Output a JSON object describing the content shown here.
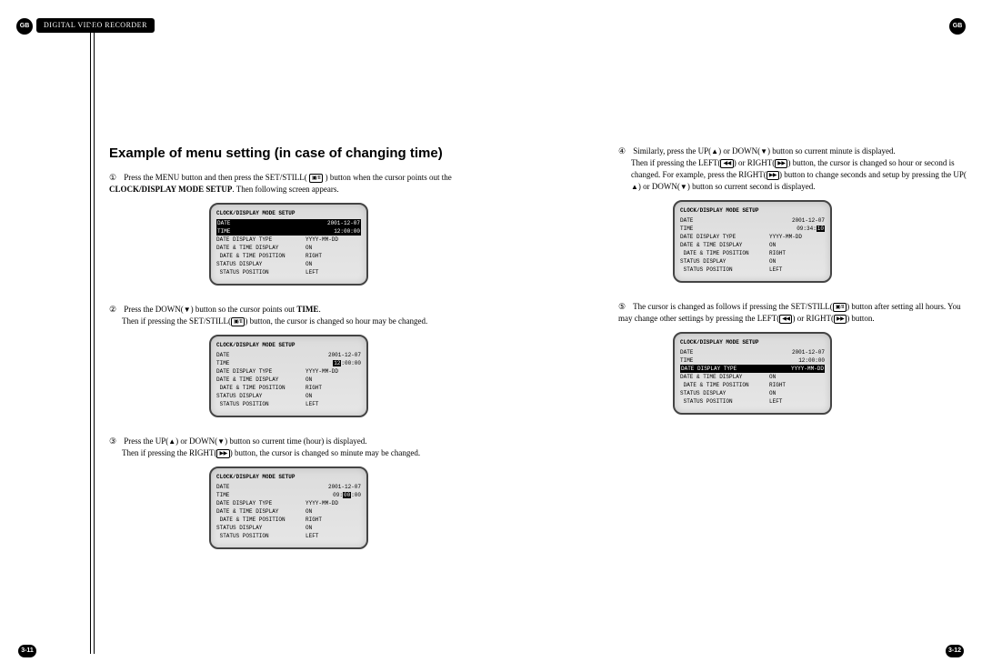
{
  "badges": {
    "left": "GB",
    "right": "GB"
  },
  "header": "DIGITAL VIDEO RECORDER",
  "title": "Example of menu setting (in case of changing time)",
  "icons": {
    "up": "▲",
    "down": "▼",
    "left": "◀◀",
    "right": "▶▶",
    "setstill": "▣/II"
  },
  "steps": {
    "s1a": "Press the MENU button and then press the SET/STILL(",
    "s1b": ") button when the cursor points out the ",
    "s1bold": "CLOCK/DISPLAY MODE SETUP",
    "s1c": ". Then following screen appears.",
    "s2a": "Press the DOWN(",
    "s2b": ") button so the cursor points out ",
    "s2bold": "TIME",
    "s2c": ".",
    "s2d": "Then if pressing the SET/STILL(",
    "s2e": ") button, the cursor is changed so hour may be changed.",
    "s3a": "Press the UP(",
    "s3b": ") or DOWN(",
    "s3c": ") button so current time (hour) is displayed.",
    "s3d": "Then if pressing the RIGHT(",
    "s3e": ") button, the cursor is changed so minute may be changed.",
    "s4a": "Similarly, press the UP(",
    "s4b": ") or DOWN(",
    "s4c": ") button so current minute is displayed.",
    "s4d": "Then if pressing the LEFT(",
    "s4e": ") or RIGHT(",
    "s4f": ") button, the cursor is changed so hour or second is changed. For example, press the RIGHT(",
    "s4g": ") button to change seconds and setup by pressing the UP(",
    "s4h": ") or DOWN(",
    "s4i": ") button so current second is displayed.",
    "s5a": "The cursor is changed as follows if pressing the SET/STILL(",
    "s5b": ") button after setting all hours. You may change other settings by pressing the LEFT(",
    "s5c": ") or RIGHT(",
    "s5d": ") button."
  },
  "nums": {
    "n1": "①",
    "n2": "②",
    "n3": "③",
    "n4": "④",
    "n5": "⑤"
  },
  "osd_title": "CLOCK/DISPLAY MODE SETUP",
  "osd_labels": {
    "date": "DATE",
    "time": "TIME",
    "ddt": "DATE DISPLAY TYPE",
    "dtd": "DATE & TIME DISPLAY",
    "dtp": " DATE & TIME POSITION",
    "sd": "STATUS DISPLAY",
    "sp": " STATUS POSITION"
  },
  "osd_common": {
    "date": "2001-12-07",
    "ddt": "YYYY-MM-DD",
    "dtd": "ON",
    "dtp": "RIGHT",
    "sd": "ON",
    "sp": "LEFT"
  },
  "osd1": {
    "time": "12:00:00"
  },
  "osd2": {
    "time_hour": "12",
    "time_rest": ":00:00"
  },
  "osd3": {
    "time_pre": "09:",
    "time_min": "00",
    "time_post": ":00"
  },
  "osd4": {
    "time_pre": "09:34:",
    "time_sec": "10"
  },
  "osd5": {
    "time": "12:00:00"
  },
  "pages": {
    "left": "3-11",
    "right": "3-12"
  }
}
